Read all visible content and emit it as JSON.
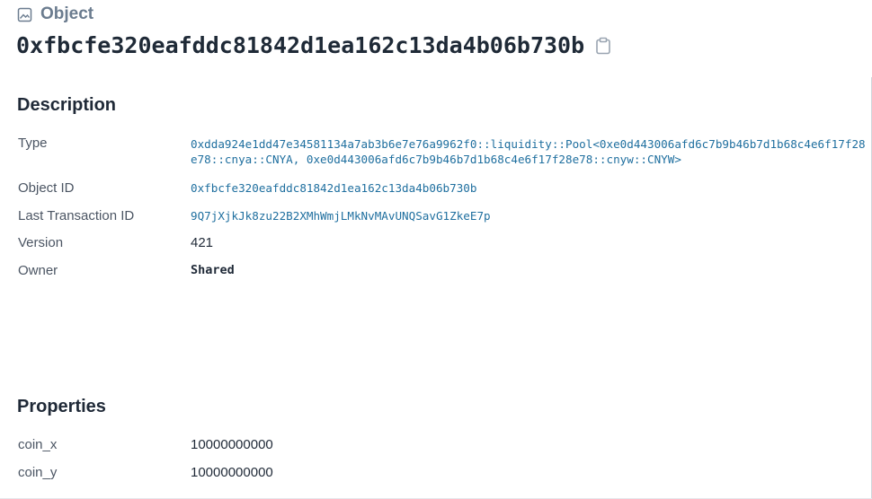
{
  "header": {
    "kind_label": "Object",
    "kind_icon": "image-icon",
    "object_id": "0xfbcfe320eafddc81842d1ea162c13da4b06b730b",
    "copy_icon": "clipboard-icon"
  },
  "description": {
    "title": "Description",
    "type_label": "Type",
    "type_value": "0xdda924e1dd47e34581134a7ab3b6e7e76a9962f0::liquidity::Pool<0xe0d443006afd6c7b9b46b7d1b68c4e6f17f28e78::cnya::CNYA, 0xe0d443006afd6c7b9b46b7d1b68c4e6f17f28e78::cnyw::CNYW>",
    "object_id_label": "Object ID",
    "object_id_value": "0xfbcfe320eafddc81842d1ea162c13da4b06b730b",
    "last_tx_label": "Last Transaction ID",
    "last_tx_value": "9Q7jXjkJk8zu22B2XMhWmjLMkNvMAvUNQSavG1ZkeE7p",
    "version_label": "Version",
    "version_value": "421",
    "owner_label": "Owner",
    "owner_value": "Shared"
  },
  "properties": {
    "title": "Properties",
    "items": [
      {
        "label": "coin_x",
        "value": "10000000000"
      },
      {
        "label": "coin_y",
        "value": "10000000000"
      }
    ]
  },
  "colors": {
    "link": "#1f6f9f",
    "muted_header": "#6b7c8f",
    "text": "#1f2937",
    "label": "#4b5563"
  }
}
